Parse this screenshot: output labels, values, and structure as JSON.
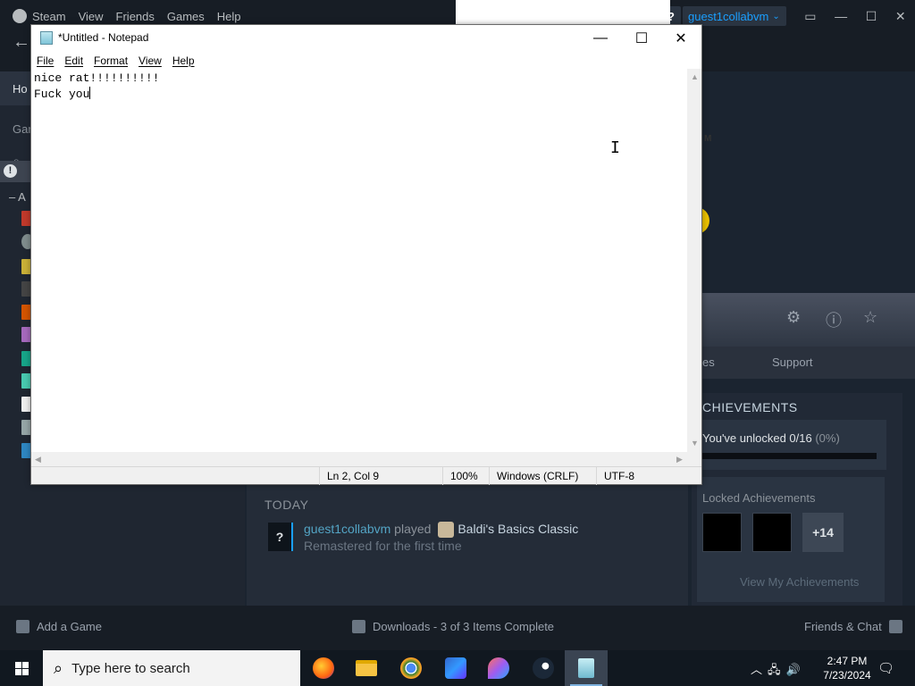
{
  "steam": {
    "menu": [
      "Steam",
      "View",
      "Friends",
      "Games",
      "Help"
    ],
    "help_label": "?",
    "account": "guest1collabvm",
    "sidebar": {
      "home": "Ho",
      "games": "Gar",
      "all": "A"
    },
    "tabs": {
      "partial": "es",
      "support": "Support"
    },
    "achievements": {
      "title": "ACHIEVEMENTS",
      "title_visible": "CHIEVEMENTS",
      "unlocked_text": "You've unlocked 0/16",
      "unlocked_pct": "(0%)",
      "progress": 0,
      "locked_label": "Locked Achievements",
      "more": "+14",
      "view_link": "View My Achievements"
    },
    "activity": {
      "heading": "TODAY",
      "user": "guest1collabvm",
      "verb": "played",
      "game": "Baldi's Basics Classic",
      "line2": "Remastered for the first time"
    },
    "bottom": {
      "add_game": "Add a Game",
      "downloads": "Downloads - 3 of 3 Items Complete",
      "friends": "Friends & Chat"
    }
  },
  "notepad": {
    "title": "*Untitled - Notepad",
    "menu": [
      "File",
      "Edit",
      "Format",
      "View",
      "Help"
    ],
    "text_line1": "nice rat!!!!!!!!!!",
    "text_line2": "Fuck you",
    "status": {
      "position": "Ln 2, Col 9",
      "zoom": "100%",
      "line_ending": "Windows (CRLF)",
      "encoding": "UTF-8"
    }
  },
  "taskbar": {
    "search_placeholder": "Type here to search",
    "apps": [
      "firefox-icon",
      "file-explorer-icon",
      "chrome-icon",
      "copilot-icon",
      "paint-icon",
      "steam-icon",
      "notepad-icon"
    ],
    "time": "2:47 PM",
    "date": "7/23/2024"
  },
  "colors": {
    "steam_accent": "#1a9fff",
    "steam_bg": "#171d25",
    "taskbar_bg": "#111820"
  }
}
